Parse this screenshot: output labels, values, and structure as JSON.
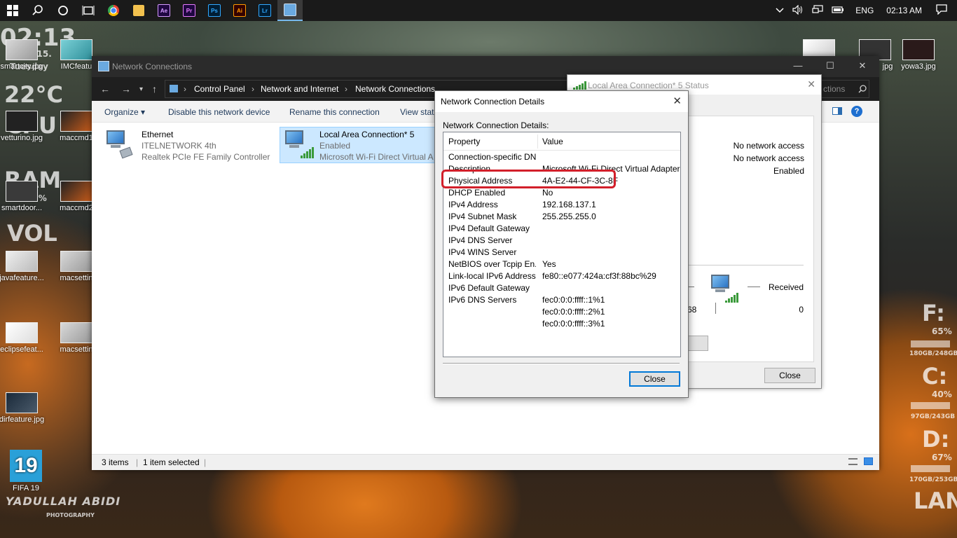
{
  "taskbar": {
    "apps": [
      {
        "name": "chrome",
        "label": "",
        "color": "#e8453c",
        "fg": "#fff"
      },
      {
        "name": "file-explorer",
        "label": "",
        "color": "#f2c14e",
        "fg": "#000"
      },
      {
        "name": "after-effects",
        "label": "Ae",
        "color": "#1f0740",
        "fg": "#d59bff"
      },
      {
        "name": "premiere",
        "label": "Pr",
        "color": "#1f0740",
        "fg": "#e77bff"
      },
      {
        "name": "photoshop",
        "label": "Ps",
        "color": "#001d34",
        "fg": "#31a8ff"
      },
      {
        "name": "illustrator",
        "label": "Ai",
        "color": "#330000",
        "fg": "#ff9a00"
      },
      {
        "name": "lightroom",
        "label": "Lr",
        "color": "#001d34",
        "fg": "#31a8ff"
      },
      {
        "name": "control-panel",
        "label": "",
        "color": "#6aa9e0",
        "fg": "#fff"
      }
    ],
    "language": "ENG",
    "time": "02:13 AM"
  },
  "desktop": {
    "widgets": {
      "clock": "02:13",
      "date": "19.10.15.",
      "day": "Tuesday",
      "temp": "22°C",
      "cpu": "CPU",
      "ram": "RAM",
      "ram_pct": "73%",
      "vol": "VOL",
      "f_drive": "F:",
      "f_pct": "65%",
      "f_size": "180GB/248GB",
      "c_drive": "C:",
      "c_pct": "40%",
      "c_size": "97GB/243GB",
      "d_drive": "D:",
      "d_pct": "67%",
      "d_size": "170GB/253GB",
      "lan": "LAN",
      "photographer": "YADULLAH ABIDI",
      "photographer_sub": "PHOTOGRAPHY"
    },
    "icons": [
      {
        "label": "smartcity.jpg"
      },
      {
        "label": "IMCfeatu"
      },
      {
        "label": "vetturino.jpg"
      },
      {
        "label": "maccmd1"
      },
      {
        "label": "smartdoor..."
      },
      {
        "label": "maccmd2"
      },
      {
        "label": "javafeature..."
      },
      {
        "label": "macsettin"
      },
      {
        "label": "eclipsefeat..."
      },
      {
        "label": "macsettin"
      },
      {
        "label": "dirfeature.jpg"
      },
      {
        "label": "FIFA 19"
      },
      {
        "label": "jpg"
      },
      {
        "label": "yowa3.jpg"
      }
    ]
  },
  "explorer": {
    "title": "Network Connections",
    "breadcrumb": [
      "Control Panel",
      "Network and Internet",
      "Network Connections"
    ],
    "search_placeholder": "ctions",
    "toolbar": [
      "Organize ▾",
      "Disable this network device",
      "Rename this connection",
      "View statu"
    ],
    "connections": [
      {
        "name": "Ethernet",
        "network": "ITELNETWORK 4th",
        "adapter": "Realtek PCIe FE Family Controller"
      },
      {
        "name": "Local Area Connection* 5",
        "network": "Enabled",
        "adapter": "Microsoft Wi-Fi Direct Virtual A"
      }
    ],
    "status": {
      "items": "3 items",
      "selected": "1 item selected"
    }
  },
  "status_dialog": {
    "title": "Local Area Connection* 5 Status",
    "ipv4": "No network access",
    "ipv6": "No network access",
    "media": "Enabled",
    "received_label": "Received",
    "sent_partial": "68",
    "received_value": "0",
    "close": "Close"
  },
  "details_dialog": {
    "title": "Network Connection Details",
    "label": "Network Connection Details:",
    "col_property": "Property",
    "col_value": "Value",
    "rows": [
      {
        "p": "Connection-specific DN...",
        "v": ""
      },
      {
        "p": "Description",
        "v": "Microsoft Wi-Fi Direct Virtual Adapter #7"
      },
      {
        "p": "Physical Address",
        "v": "4A-E2-44-CF-3C-8F"
      },
      {
        "p": "DHCP Enabled",
        "v": "No"
      },
      {
        "p": "IPv4 Address",
        "v": "192.168.137.1"
      },
      {
        "p": "IPv4 Subnet Mask",
        "v": "255.255.255.0"
      },
      {
        "p": "IPv4 Default Gateway",
        "v": ""
      },
      {
        "p": "IPv4 DNS Server",
        "v": ""
      },
      {
        "p": "IPv4 WINS Server",
        "v": ""
      },
      {
        "p": "NetBIOS over Tcpip En...",
        "v": "Yes"
      },
      {
        "p": "Link-local IPv6 Address",
        "v": "fe80::e077:424a:cf3f:88bc%29"
      },
      {
        "p": "IPv6 Default Gateway",
        "v": ""
      },
      {
        "p": "IPv6 DNS Servers",
        "v": "fec0:0:0:ffff::1%1"
      },
      {
        "p": "",
        "v": "fec0:0:0:ffff::2%1"
      },
      {
        "p": "",
        "v": "fec0:0:0:ffff::3%1"
      }
    ],
    "close": "Close"
  }
}
